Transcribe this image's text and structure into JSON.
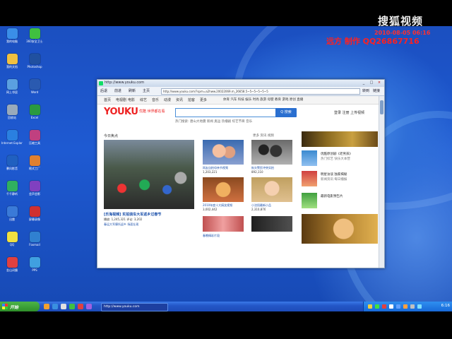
{
  "watermark": {
    "logo": "搜狐视频",
    "time": "2010-08-05 06:16",
    "credit": "远方 制作 QQ26867716"
  },
  "colors": {
    "desktop": "#1e5ad2",
    "window_accent": "#2a6fd0",
    "youku_red": "#e22",
    "start_green": "#2f8f2a"
  },
  "desktop_icons": [
    {
      "label": "我的电脑",
      "icon": "computer-icon",
      "color": "#3a8ee8"
    },
    {
      "label": "我的文档",
      "icon": "folder-icon",
      "color": "#f0c040"
    },
    {
      "label": "网上邻居",
      "icon": "network-icon",
      "color": "#5aa0e0"
    },
    {
      "label": "回收站",
      "icon": "recycle-bin-icon",
      "color": "#9ab"
    },
    {
      "label": "Internet Explorer",
      "icon": "ie-icon",
      "color": "#2a80e0"
    },
    {
      "label": "暴风影音",
      "icon": "media-player-icon",
      "color": "#2060c0"
    },
    {
      "label": "千千静听",
      "icon": "music-icon",
      "color": "#30b060"
    },
    {
      "label": "迅雷",
      "icon": "download-icon",
      "color": "#3a7ad8"
    },
    {
      "label": "QQ",
      "icon": "qq-icon",
      "color": "#f0e040"
    },
    {
      "label": "金山词霸",
      "icon": "dictionary-icon",
      "color": "#e04040"
    },
    {
      "label": "360安全卫士",
      "icon": "shield-icon",
      "color": "#40c040"
    },
    {
      "label": "Photoshop",
      "icon": "photoshop-icon",
      "color": "#2050a0"
    },
    {
      "label": "Word",
      "icon": "word-icon",
      "color": "#2a5ab0"
    },
    {
      "label": "Excel",
      "icon": "excel-icon",
      "color": "#2a9a40"
    },
    {
      "label": "压缩工具",
      "icon": "archive-icon",
      "color": "#c04080"
    },
    {
      "label": "格式工厂",
      "icon": "converter-icon",
      "color": "#e08030"
    },
    {
      "label": "会声会影",
      "icon": "video-editor-icon",
      "color": "#8040c0"
    },
    {
      "label": "屏幕录像",
      "icon": "recorder-icon",
      "color": "#d03030"
    },
    {
      "label": "Foxmail",
      "icon": "mail-icon",
      "color": "#3080d0"
    },
    {
      "label": "PPS",
      "icon": "pps-icon",
      "color": "#40a0e0"
    }
  ],
  "window": {
    "title": "http://www.youku.com",
    "nav": [
      "后退",
      "前进",
      "刷新",
      "主页"
    ],
    "address": "http://www.youku.com/?spm=a2hww.20022069.m_26658.5~5~5~5~5~5",
    "go": "转到",
    "links": "链接"
  },
  "site": {
    "nav": [
      "首页",
      "电视剧",
      "电影",
      "综艺",
      "音乐",
      "动漫",
      "资讯",
      "拍客",
      "更多"
    ],
    "channels": "体育 汽车 科技 娱乐 时尚 旅游 母婴 教育 游戏 原创 直播",
    "logo_main": "YOUKU",
    "logo_cn": "优酷",
    "logo_sub": "世界都在看",
    "search_placeholder": "",
    "search_button": "Q 搜索",
    "suggest": "热门搜索: 唐山大地震 新闻 奥运 热播剧 综艺节目 音乐",
    "header_links": "登录  注册  上传视频",
    "section_title": "今日焦点",
    "section_links": "更多   资讯   视频"
  },
  "videos": {
    "feature_caption": "[乐淘视频] 实拍骑车大军返乡过春节",
    "feature_meta": "播放: 1,245,321  评论: 3,202",
    "feature_sub": "春运大军摩托返乡 场面壮观",
    "thumbs": [
      {
        "caption": "网友自拍母亲节视频",
        "meta": "1,203,221"
      },
      {
        "caption": "街头警民冲突实拍",
        "meta": "892,110"
      },
      {
        "caption": "2010年度十大搞笑视频",
        "meta": "3,002,442"
      },
      {
        "caption": "小沈阳最新小品",
        "meta": "2,310,876"
      },
      {
        "caption": "春晚精彩片段",
        "meta": ""
      }
    ],
    "right_list": [
      "优酷原创剧《老男孩》",
      "明星访谈 独家揭秘",
      "最新电影预告片",
      "热门综艺 快乐大本营",
      "新闻资讯 每日播报"
    ]
  },
  "taskbar": {
    "start": "开始",
    "task": "http://www.youku.com",
    "clock": "6:16"
  }
}
